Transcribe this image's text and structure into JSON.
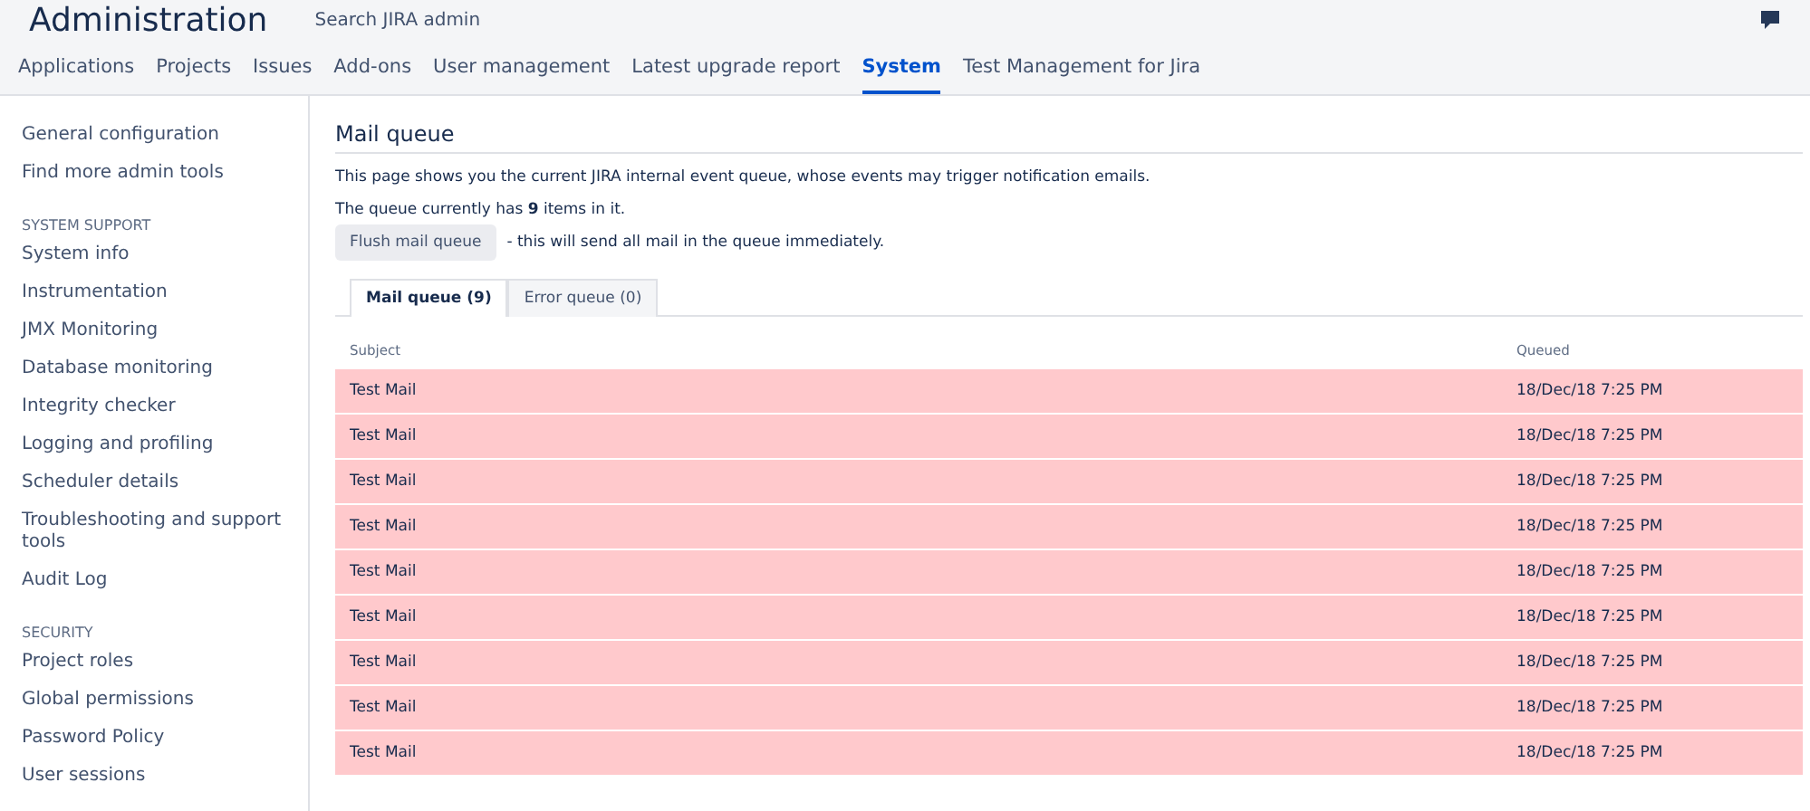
{
  "header": {
    "title": "Administration",
    "search": {
      "placeholder": "Search JIRA admin"
    }
  },
  "tabs": [
    {
      "label": "Applications",
      "selected": false
    },
    {
      "label": "Projects",
      "selected": false
    },
    {
      "label": "Issues",
      "selected": false
    },
    {
      "label": "Add-ons",
      "selected": false
    },
    {
      "label": "User management",
      "selected": false
    },
    {
      "label": "Latest upgrade report",
      "selected": false
    },
    {
      "label": "System",
      "selected": true
    },
    {
      "label": "Test Management for Jira",
      "selected": false
    }
  ],
  "sidebar": {
    "items": [
      {
        "kind": "link",
        "label": "General configuration"
      },
      {
        "kind": "link",
        "label": "Find more admin tools"
      },
      {
        "kind": "heading",
        "label": "SYSTEM SUPPORT"
      },
      {
        "kind": "link",
        "label": "System info"
      },
      {
        "kind": "link",
        "label": "Instrumentation"
      },
      {
        "kind": "link",
        "label": "JMX Monitoring"
      },
      {
        "kind": "link",
        "label": "Database monitoring"
      },
      {
        "kind": "link",
        "label": "Integrity checker"
      },
      {
        "kind": "link",
        "label": "Logging and profiling"
      },
      {
        "kind": "link",
        "label": "Scheduler details"
      },
      {
        "kind": "link",
        "label": "Troubleshooting and support tools"
      },
      {
        "kind": "link",
        "label": "Audit Log"
      },
      {
        "kind": "heading",
        "label": "SECURITY"
      },
      {
        "kind": "link",
        "label": "Project roles"
      },
      {
        "kind": "link",
        "label": "Global permissions"
      },
      {
        "kind": "link",
        "label": "Password Policy"
      },
      {
        "kind": "link",
        "label": "User sessions"
      }
    ]
  },
  "main": {
    "title": "Mail queue",
    "description": "This page shows you the current JIRA internal event queue, whose events may trigger notification emails.",
    "count_text": "The queue currently has **9** items in it.",
    "flush_button": "Flush mail queue",
    "flush_note": "- this will send all mail in the queue immediately.",
    "queue_tabs": [
      {
        "label": "Mail queue (9)",
        "selected": true
      },
      {
        "label": "Error queue (0)",
        "selected": false
      }
    ],
    "table": {
      "columns": [
        "Subject",
        "Queued"
      ],
      "rows": [
        {
          "subject": "Test Mail",
          "queued": "18/Dec/18 7:25 PM"
        },
        {
          "subject": "Test Mail",
          "queued": "18/Dec/18 7:25 PM"
        },
        {
          "subject": "Test Mail",
          "queued": "18/Dec/18 7:25 PM"
        },
        {
          "subject": "Test Mail",
          "queued": "18/Dec/18 7:25 PM"
        },
        {
          "subject": "Test Mail",
          "queued": "18/Dec/18 7:25 PM"
        },
        {
          "subject": "Test Mail",
          "queued": "18/Dec/18 7:25 PM"
        },
        {
          "subject": "Test Mail",
          "queued": "18/Dec/18 7:25 PM"
        },
        {
          "subject": "Test Mail",
          "queued": "18/Dec/18 7:25 PM"
        },
        {
          "subject": "Test Mail",
          "queued": "18/Dec/18 7:25 PM"
        }
      ]
    }
  }
}
